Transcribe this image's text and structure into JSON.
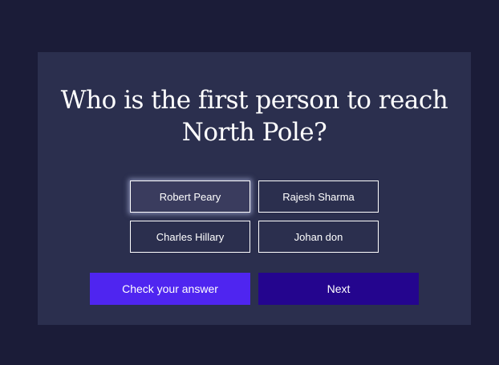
{
  "quiz": {
    "question": "Who is the first person to reach North Pole?",
    "options": [
      {
        "label": "Robert Peary",
        "selected": true
      },
      {
        "label": "Rajesh Sharma",
        "selected": false
      },
      {
        "label": "Charles Hillary",
        "selected": false
      },
      {
        "label": "Johan don",
        "selected": false
      }
    ],
    "check_label": "Check your answer",
    "next_label": "Next"
  },
  "colors": {
    "page_background": "#1b1c38",
    "card_background": "#2b2f4e",
    "check_button": "#4f25f0",
    "next_button": "#24058e",
    "text": "#ffffff"
  }
}
